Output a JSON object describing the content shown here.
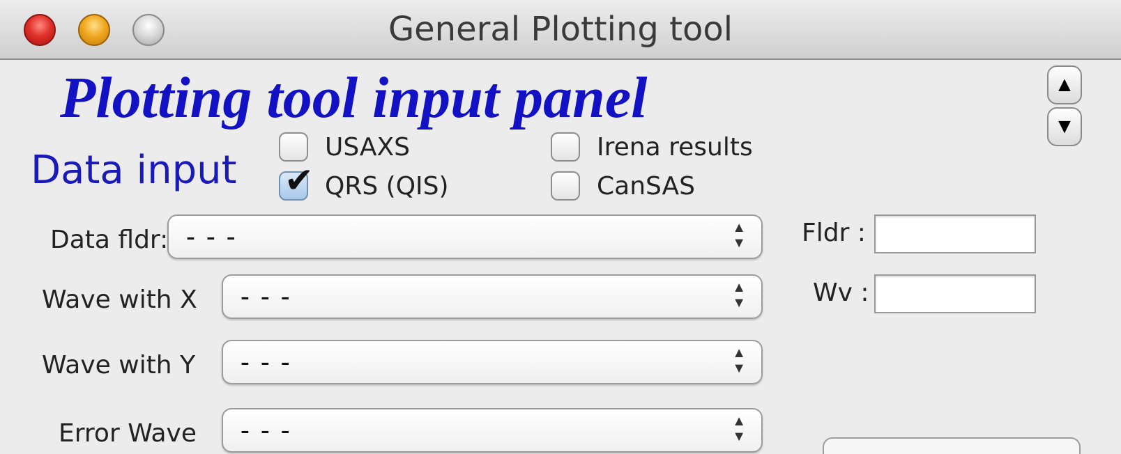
{
  "window": {
    "title": "General Plotting tool",
    "buttons": [
      "close",
      "minimize",
      "zoom"
    ]
  },
  "panel": {
    "heading": "Plotting tool input panel",
    "heading_color": "#1212c4"
  },
  "scroll": {
    "up_icon": "▲",
    "down_icon": "▼"
  },
  "data_input": {
    "label": "Data input",
    "checkboxes": [
      {
        "label": "USAXS",
        "checked": false
      },
      {
        "label": "QRS (QIS)",
        "checked": true
      },
      {
        "label": "Irena results",
        "checked": false
      },
      {
        "label": "CanSAS",
        "checked": false
      }
    ]
  },
  "fields": {
    "data_fldr": {
      "label": "Data fldr:",
      "value": "---"
    },
    "wave_x": {
      "label": "Wave with X",
      "value": "---"
    },
    "wave_y": {
      "label": "Wave with Y",
      "value": "---"
    },
    "error_wave": {
      "label": "Error Wave",
      "value": "---"
    }
  },
  "filters": {
    "fldr": {
      "label": "Fldr :",
      "value": ""
    },
    "wv": {
      "label": "Wv :",
      "value": ""
    }
  },
  "icons": {
    "checkmark": "✔",
    "popup_arrows": "▲▼"
  }
}
